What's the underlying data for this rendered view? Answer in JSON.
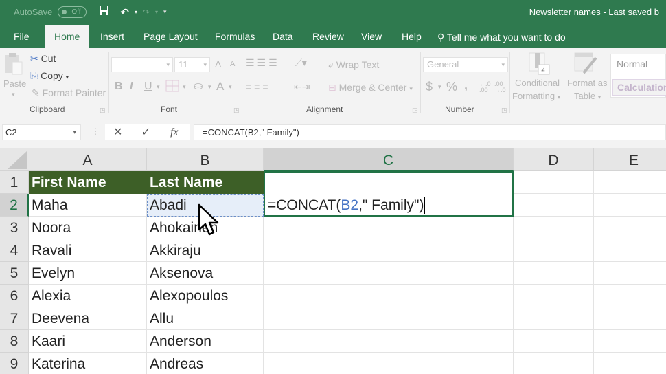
{
  "titlebar": {
    "autosave_label": "AutoSave",
    "autosave_state": "Off",
    "doc_title": "Newsletter names  -  Last saved b"
  },
  "tabs": [
    {
      "label": "File",
      "active": false
    },
    {
      "label": "Home",
      "active": true
    },
    {
      "label": "Insert",
      "active": false
    },
    {
      "label": "Page Layout",
      "active": false
    },
    {
      "label": "Formulas",
      "active": false
    },
    {
      "label": "Data",
      "active": false
    },
    {
      "label": "Review",
      "active": false
    },
    {
      "label": "View",
      "active": false
    },
    {
      "label": "Help",
      "active": false
    }
  ],
  "tell_me": "Tell me what you want to do",
  "ribbon": {
    "clipboard": {
      "label": "Clipboard",
      "paste": "Paste",
      "cut": "Cut",
      "copy": "Copy",
      "format_painter": "Format Painter"
    },
    "font": {
      "label": "Font",
      "font_name": "",
      "font_size": "11",
      "bold": "B",
      "italic": "I",
      "underline": "U",
      "font_color": "A",
      "grow": "A",
      "shrink": "A"
    },
    "alignment": {
      "label": "Alignment",
      "wrap_text": "Wrap Text",
      "merge_center": "Merge & Center"
    },
    "number": {
      "label": "Number",
      "format": "General",
      "currency": "$",
      "percent": "%",
      "comma": ","
    },
    "styles": {
      "conditional_formatting_1": "Conditional",
      "conditional_formatting_2": "Formatting",
      "format_as_table_1": "Format as",
      "format_as_table_2": "Table",
      "normal": "Normal",
      "calculation": "Calculation"
    }
  },
  "formula_bar": {
    "name_box": "C2",
    "cancel": "✕",
    "enter": "✓",
    "fx": "fx",
    "formula": "=CONCAT(B2,\" Family\")"
  },
  "sheet": {
    "columns": [
      "A",
      "B",
      "C",
      "D",
      "E"
    ],
    "selected_column": "C",
    "selected_row": 2,
    "rows": [
      {
        "num": "1",
        "a": "First Name",
        "b": "Last Name"
      },
      {
        "num": "2",
        "a": "Maha",
        "b": "Abadi"
      },
      {
        "num": "3",
        "a": "Noora",
        "b": "Ahokainen"
      },
      {
        "num": "4",
        "a": "Ravali",
        "b": "Akkiraju"
      },
      {
        "num": "5",
        "a": "Evelyn",
        "b": "Aksenova"
      },
      {
        "num": "6",
        "a": "Alexia",
        "b": "Alexopoulos"
      },
      {
        "num": "7",
        "a": "Deevena",
        "b": "Allu"
      },
      {
        "num": "8",
        "a": "Kaari",
        "b": "Anderson"
      },
      {
        "num": "9",
        "a": "Katerina",
        "b": "Andreas"
      }
    ],
    "edit": {
      "prefix": "=CONCAT(",
      "ref": "B2",
      "suffix": ",\" Family\")"
    }
  },
  "colors": {
    "brand_green": "#2f7a4f",
    "header_fill": "#3d5f27",
    "ref_blue": "#4472c4",
    "selection_green": "#217346"
  }
}
